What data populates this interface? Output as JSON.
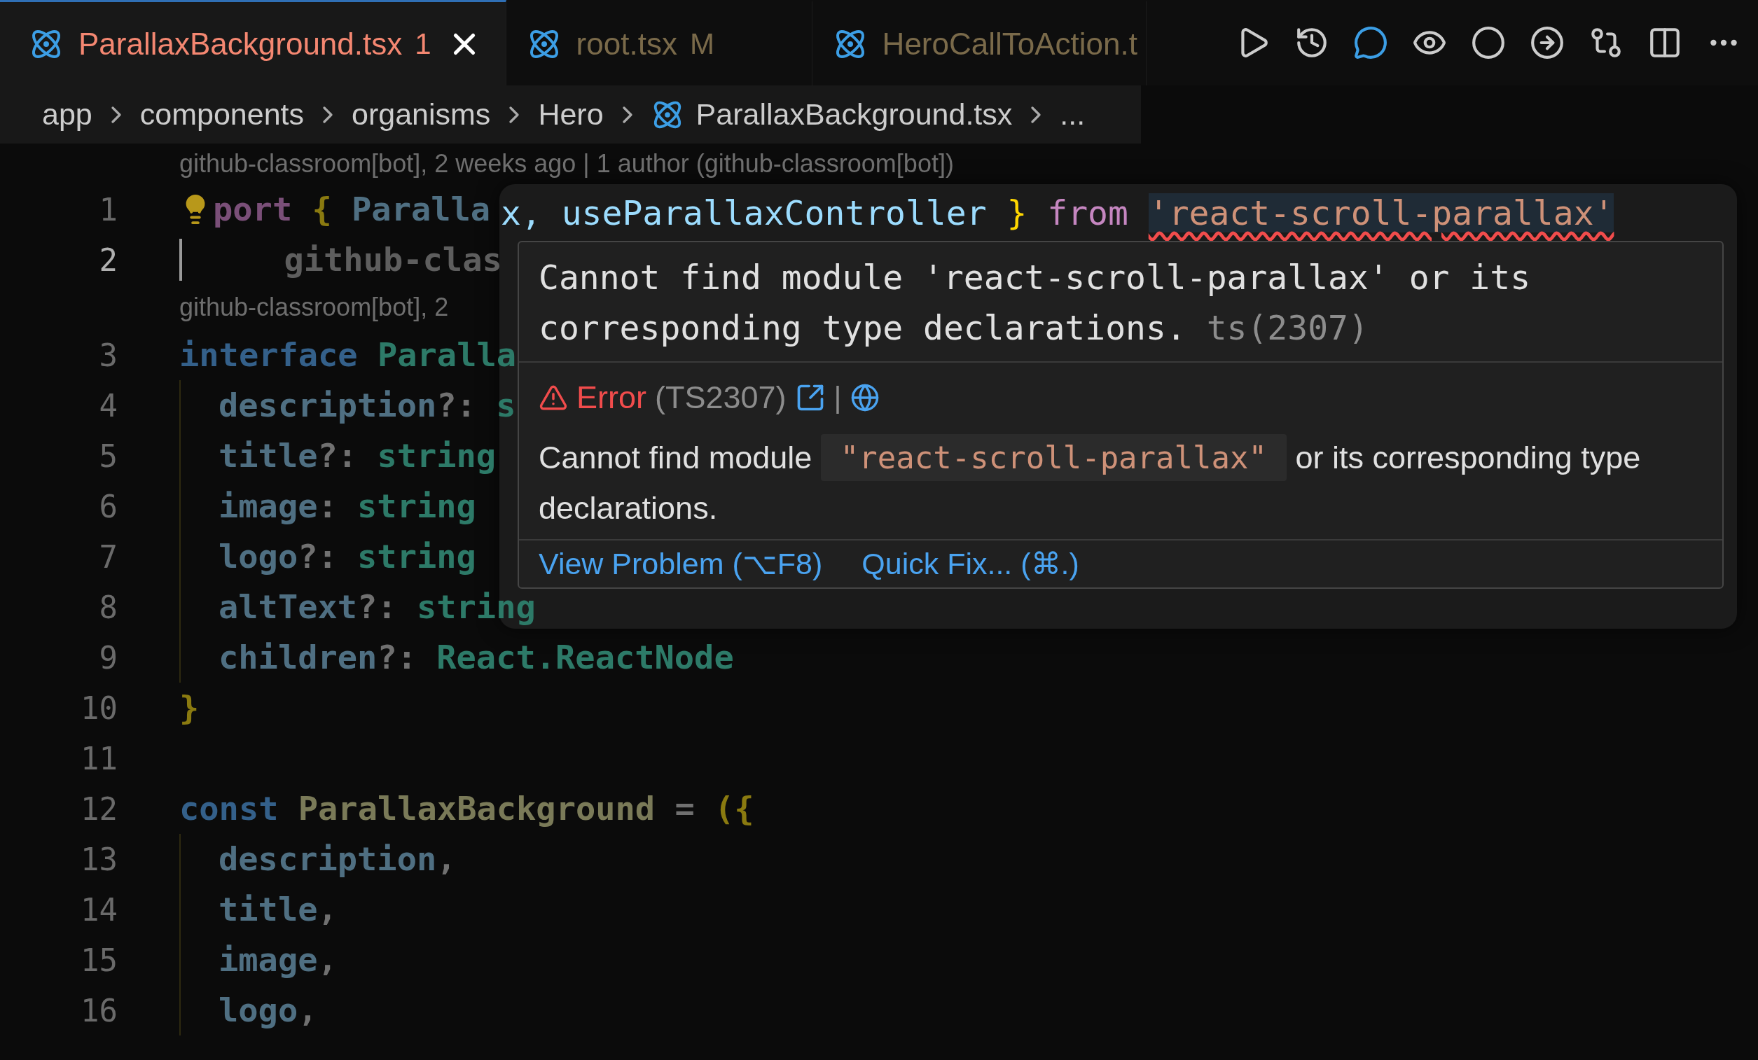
{
  "tabs": [
    {
      "label": "ParallaxBackground.tsx",
      "badge": "1",
      "selected": true
    },
    {
      "label": "root.tsx",
      "badge": "M",
      "selected": false
    },
    {
      "label": "HeroCallToAction.t",
      "selected": false
    }
  ],
  "breadcrumbs": [
    {
      "label": "app",
      "kind": "folder"
    },
    {
      "label": "components",
      "kind": "folder"
    },
    {
      "label": "organisms",
      "kind": "folder"
    },
    {
      "label": "Hero",
      "kind": "folder"
    },
    {
      "label": "ParallaxBackground.tsx",
      "kind": "file"
    },
    {
      "label": "...",
      "kind": "more"
    }
  ],
  "code_lines": [
    {
      "kind": "blame",
      "text": "github-classroom[bot], 2 weeks ago | 1 author (github-classroom[bot])"
    },
    {
      "kind": "code",
      "number": "1",
      "current": false,
      "lightbulb": true,
      "indented": false,
      "tokens": [
        {
          "text": "port",
          "kind": "keyword"
        },
        {
          "text": " { ",
          "kind": "brace"
        },
        {
          "text": "Paralla",
          "kind": "variable"
        }
      ]
    },
    {
      "kind": "code",
      "number": "2",
      "current": true,
      "lightbulb": false,
      "indented": false,
      "tokens": [
        {
          "text": "     github-clas",
          "kind": "comment"
        }
      ]
    },
    {
      "kind": "blame",
      "text": "github-classroom[bot], 2"
    },
    {
      "kind": "code",
      "number": "3",
      "current": false,
      "lightbulb": false,
      "indented": false,
      "tokens": [
        {
          "text": "interface",
          "kind": "storage"
        },
        {
          "text": " Paralla",
          "kind": "type"
        }
      ]
    },
    {
      "kind": "code",
      "number": "4",
      "current": false,
      "lightbulb": false,
      "indented": true,
      "tokens": [
        {
          "text": "description",
          "kind": "variable"
        },
        {
          "text": "?: ",
          "kind": "plain"
        },
        {
          "text": "s",
          "kind": "type"
        }
      ]
    },
    {
      "kind": "code",
      "number": "5",
      "current": false,
      "lightbulb": false,
      "indented": true,
      "tokens": [
        {
          "text": "title",
          "kind": "variable"
        },
        {
          "text": "?: ",
          "kind": "plain"
        },
        {
          "text": "string",
          "kind": "type"
        }
      ]
    },
    {
      "kind": "code",
      "number": "6",
      "current": false,
      "lightbulb": false,
      "indented": true,
      "tokens": [
        {
          "text": "image",
          "kind": "variable"
        },
        {
          "text": ": ",
          "kind": "plain"
        },
        {
          "text": "string",
          "kind": "type"
        }
      ]
    },
    {
      "kind": "code",
      "number": "7",
      "current": false,
      "lightbulb": false,
      "indented": true,
      "tokens": [
        {
          "text": "logo",
          "kind": "variable"
        },
        {
          "text": "?: ",
          "kind": "plain"
        },
        {
          "text": "string",
          "kind": "type"
        }
      ]
    },
    {
      "kind": "code",
      "number": "8",
      "current": false,
      "lightbulb": false,
      "indented": true,
      "tokens": [
        {
          "text": "altText",
          "kind": "variable"
        },
        {
          "text": "?: ",
          "kind": "plain"
        },
        {
          "text": "string",
          "kind": "type"
        }
      ]
    },
    {
      "kind": "code",
      "number": "9",
      "current": false,
      "lightbulb": false,
      "indented": true,
      "tokens": [
        {
          "text": "children",
          "kind": "variable"
        },
        {
          "text": "?: ",
          "kind": "plain"
        },
        {
          "text": "React.ReactNode",
          "kind": "type"
        }
      ]
    },
    {
      "kind": "code",
      "number": "10",
      "current": false,
      "lightbulb": false,
      "indented": false,
      "tokens": [
        {
          "text": "}",
          "kind": "brace"
        }
      ]
    },
    {
      "kind": "code",
      "number": "11",
      "current": false,
      "lightbulb": false,
      "indented": false
    },
    {
      "kind": "code",
      "number": "12",
      "current": false,
      "lightbulb": false,
      "indented": false,
      "tokens": [
        {
          "text": "const",
          "kind": "storage"
        },
        {
          "text": " ParallaxBackground",
          "kind": "function"
        },
        {
          "text": " = ",
          "kind": "plain"
        },
        {
          "text": "({",
          "kind": "brace"
        }
      ]
    },
    {
      "kind": "code",
      "number": "13",
      "current": false,
      "lightbulb": false,
      "indented": true,
      "tokens": [
        {
          "text": "description",
          "kind": "variable"
        },
        {
          "text": ",",
          "kind": "plain"
        }
      ]
    },
    {
      "kind": "code",
      "number": "14",
      "current": false,
      "lightbulb": false,
      "indented": true,
      "tokens": [
        {
          "text": "title",
          "kind": "variable"
        },
        {
          "text": ",",
          "kind": "plain"
        }
      ]
    },
    {
      "kind": "code",
      "number": "15",
      "current": false,
      "lightbulb": false,
      "indented": true,
      "tokens": [
        {
          "text": "image",
          "kind": "variable"
        },
        {
          "text": ",",
          "kind": "plain"
        }
      ]
    },
    {
      "kind": "code",
      "number": "16",
      "current": false,
      "lightbulb": false,
      "indented": true,
      "tokens": [
        {
          "text": "logo",
          "kind": "variable"
        },
        {
          "text": ",",
          "kind": "plain"
        }
      ]
    }
  ],
  "focus_line": {
    "tokens": [
      {
        "text": "x, useParallaxController ",
        "kind": "variable",
        "error": false
      },
      {
        "text": "}",
        "kind": "brace",
        "error": false
      },
      {
        "text": " from ",
        "kind": "keyword",
        "error": false
      },
      {
        "text": "'react-scroll-parallax'",
        "kind": "string",
        "error": true
      }
    ]
  },
  "hover": {
    "message": "Cannot find module 'react-scroll-parallax' or its corresponding type declarations.",
    "source": "ts(2307)",
    "severity": "Error",
    "code": "(TS2307)",
    "separator": "|",
    "detail_before": "Cannot find module ",
    "detail_code": "\"react-scroll-parallax\"",
    "detail_after": " or its corresponding type declarations.",
    "actions": [
      "View Problem (⌥F8)",
      "Quick Fix... (⌘.)"
    ]
  }
}
